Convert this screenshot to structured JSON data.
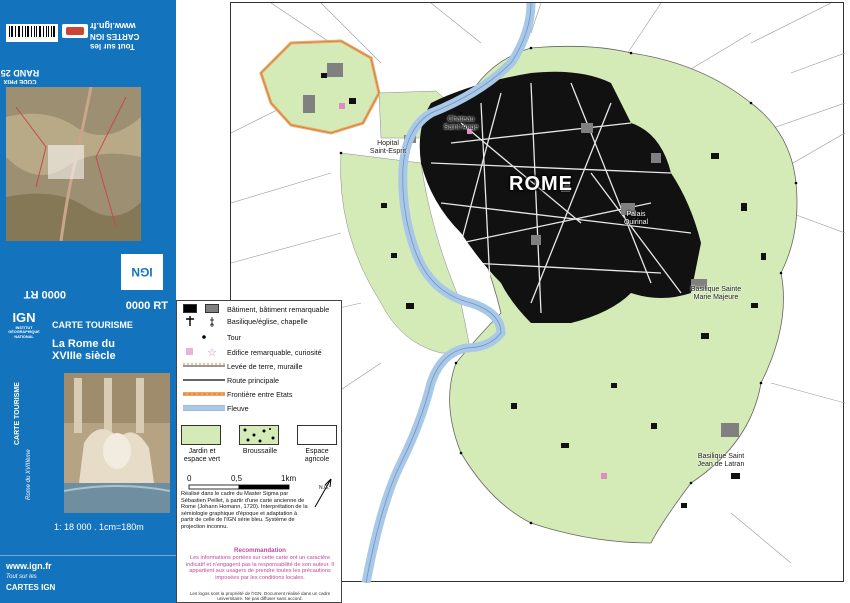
{
  "cover": {
    "top_text": [
      "Tout sur les",
      "CARTES IGN",
      "www.ign.fr"
    ],
    "code_small": "CODE PRIX",
    "code_big": "RAND 25",
    "code_upside": "0000 RT",
    "code_right": "0000 RT",
    "ign_logo": "IGN",
    "ign_logo_sub": "INSTITUT GÉOGRAPHIQUE NATIONAL",
    "series": "CARTE TOURISME",
    "title_line1": "La Rome du",
    "title_line2": "XVIIIe siècle",
    "side_series": "CARTE TOURISME",
    "side_title": "Rome du XVIIIème",
    "scale": "1: 18 000 . 1cm=180m",
    "url": "www.ign.fr",
    "bottom_line1": "Tout sur les",
    "bottom_line2": "CARTES IGN",
    "colors": {
      "background": "#1473bd"
    }
  },
  "map": {
    "city_label": "ROME",
    "labels": [
      "Chateau\nSaint-Ange",
      "Hopital\nSaint-Esprit",
      "Palais\nQuirinal",
      "Basilique Sainte\nMarie Majeure",
      "Basilique Saint\nJean de Latran"
    ],
    "colors": {
      "garden": "#d4ebb7",
      "river": "#a9c8e8",
      "buildings": "#000000",
      "remarkable": "#7f7f7f",
      "border": "#f4a460"
    }
  },
  "legend": {
    "items": [
      {
        "label": "Bâtiment, bâtiment remarquable"
      },
      {
        "label": "Basilique/église, chapelle"
      },
      {
        "label": "Tour"
      },
      {
        "label": "Edifice remarquable, curiosité"
      },
      {
        "label": "Levée de terre, muraille"
      },
      {
        "label": "Route principale"
      },
      {
        "label": "Frontière entre Etats"
      },
      {
        "label": "Fleuve"
      }
    ],
    "land_classes": [
      {
        "label": "Jardin et\nespace vert"
      },
      {
        "label": "Broussaille"
      },
      {
        "label": "Espace\nagricole"
      }
    ],
    "scale": {
      "ticks": [
        "0",
        "0,5",
        "1km"
      ]
    },
    "north": "N.G.",
    "credits": "Réalisé dans le cadre du Master Sigma par Sébastien Peillet, à partir d'une carte ancienne de Rome (Johann Homann, 1720). Interprétation de la sémiologie graphique d'époque et adaptation à partir de celle de l'IGN série bleu. Système de projection inconnu.",
    "recommendation_title": "Recommandation",
    "recommendation_text": "Les informations portées sur cette carte ont un caractère indicatif et n'engagent pas la responsabilité de son auteur. Il appartient aux usagers de prendre toutes les précautions imposées par les conditions locales.",
    "footer": "Les logos sont la propriété de l'IGN. Document réalisé dans un cadre universitaire. Ne pas diffuser sans accord."
  }
}
